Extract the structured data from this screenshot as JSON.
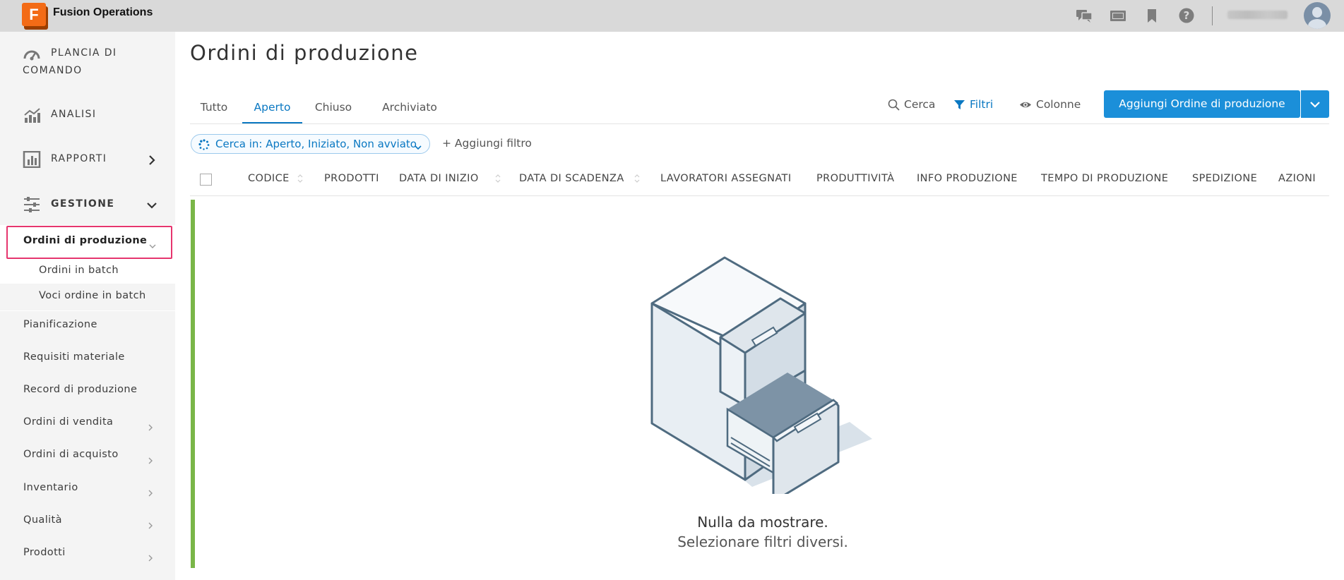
{
  "app": {
    "name": "Fusion Operations",
    "logo_letter": "F"
  },
  "topbar": {
    "icons": [
      "chat-icon",
      "screen-icon",
      "bookmark-icon",
      "help-icon"
    ]
  },
  "sidebar": {
    "main": [
      {
        "label": "PLANCIA DI",
        "label2": "COMANDO",
        "icon": "dashboard-icon"
      },
      {
        "label": "ANALISI",
        "icon": "analytics-icon"
      },
      {
        "label": "RAPPORTI",
        "icon": "reports-icon"
      },
      {
        "label": "GESTIONE",
        "icon": "sliders-icon"
      }
    ],
    "active": "Ordini di produzione",
    "active_children": [
      "Ordini in batch",
      "Voci ordine in batch"
    ],
    "items": [
      "Pianificazione",
      "Requisiti materiale",
      "Record di produzione",
      "Ordini di vendita",
      "Ordini di acquisto",
      "Inventario",
      "Qualità",
      "Prodotti"
    ]
  },
  "page": {
    "title": "Ordini di produzione"
  },
  "tabs": [
    "Tutto",
    "Aperto",
    "Chiuso",
    "Archiviato"
  ],
  "active_tab": "Aperto",
  "toolbar": {
    "search": "Cerca",
    "filters": "Filtri",
    "columns": "Colonne",
    "add_button": "Aggiungi Ordine di produzione"
  },
  "filter": {
    "chip": "Cerca in: Aperto, Iniziato, Non avviato",
    "add": "+ Aggiungi filtro"
  },
  "table": {
    "columns": [
      "CODICE",
      "PRODOTTI",
      "DATA DI INIZIO",
      "DATA DI SCADENZA",
      "LAVORATORI ASSEGNATI",
      "PRODUTTIVITÀ",
      "INFO PRODUZIONE",
      "TEMPO DI PRODUZIONE",
      "SPEDIZIONE",
      "AZIONI"
    ]
  },
  "empty_state": {
    "title": "Nulla da mostrare.",
    "subtitle": "Selezionare filtri diversi."
  },
  "colors": {
    "accent": "#1b8fd9",
    "highlight": "#e6356e",
    "status_bar": "#7ab648",
    "brand": "#f36b16"
  }
}
